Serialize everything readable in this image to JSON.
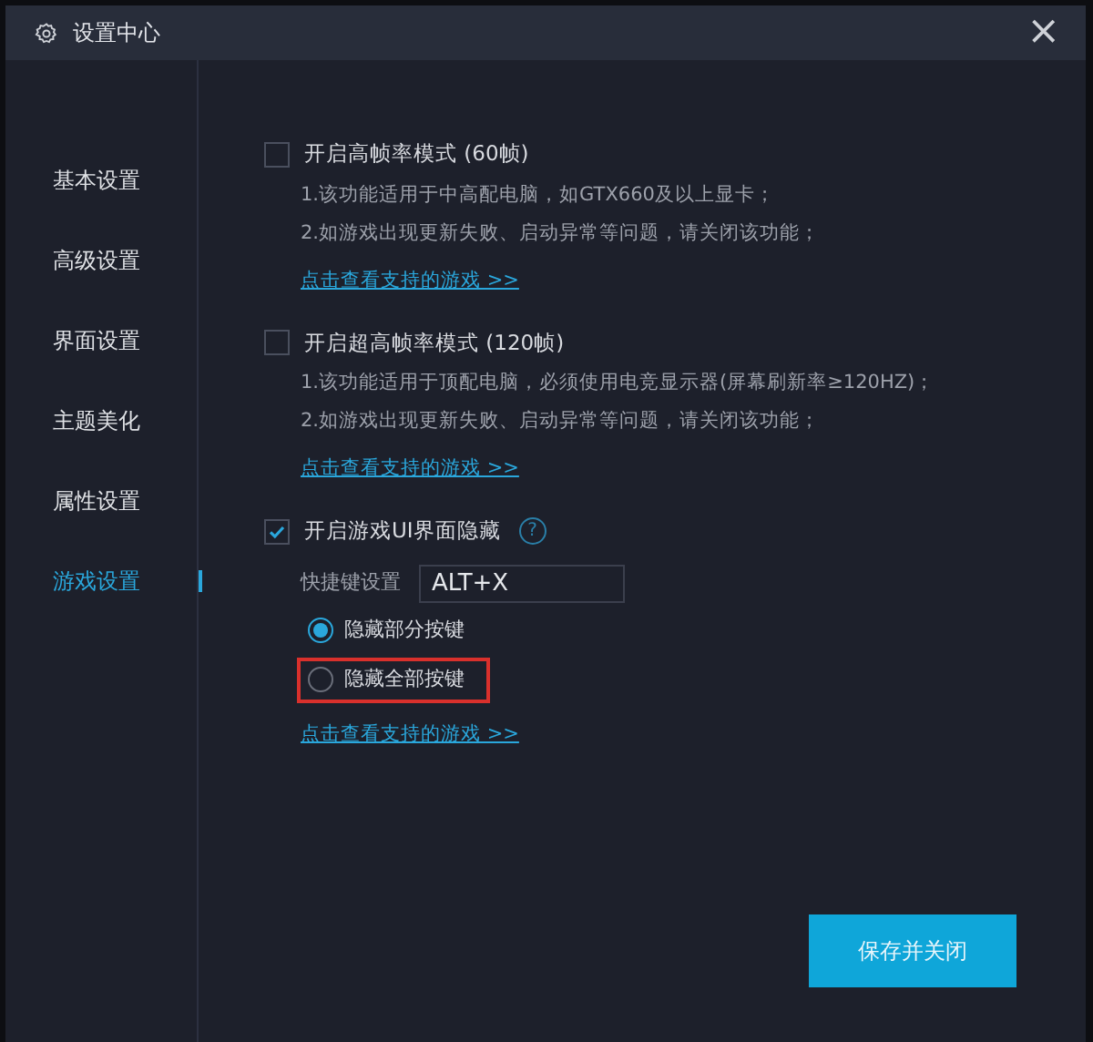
{
  "window": {
    "title": "设置中心",
    "close": "×"
  },
  "sidebar": {
    "items": [
      {
        "label": "基本设置",
        "selected": false
      },
      {
        "label": "高级设置",
        "selected": false
      },
      {
        "label": "界面设置",
        "selected": false
      },
      {
        "label": "主题美化",
        "selected": false
      },
      {
        "label": "属性设置",
        "selected": false
      },
      {
        "label": "游戏设置",
        "selected": true
      }
    ]
  },
  "sections": [
    {
      "label": "开启高帧率模式 (60帧)",
      "checked": false,
      "notes": [
        "1.该功能适用于中高配电脑，如GTX660及以上显卡；",
        "2.如游戏出现更新失败、启动异常等问题，请关闭该功能；"
      ],
      "link": "点击查看支持的游戏 >>"
    },
    {
      "label": "开启超高帧率模式 (120帧)",
      "checked": false,
      "notes": [
        "1.该功能适用于顶配电脑，必须使用电竞显示器(屏幕刷新率≥120HZ)；",
        "2.如游戏出现更新失败、启动异常等问题，请关闭该功能；"
      ],
      "link": "点击查看支持的游戏 >>"
    },
    {
      "label": "开启游戏UI界面隐藏",
      "checked": true,
      "help": "?",
      "shortcut": {
        "label": "快捷键设置",
        "value": "ALT+X"
      },
      "options": [
        {
          "label": "隐藏部分按键",
          "selected": true,
          "highlighted": false
        },
        {
          "label": "隐藏全部按键",
          "selected": false,
          "highlighted": true
        }
      ],
      "link": "点击查看支持的游戏 >>"
    }
  ],
  "buttons": [
    "保存并关闭"
  ]
}
